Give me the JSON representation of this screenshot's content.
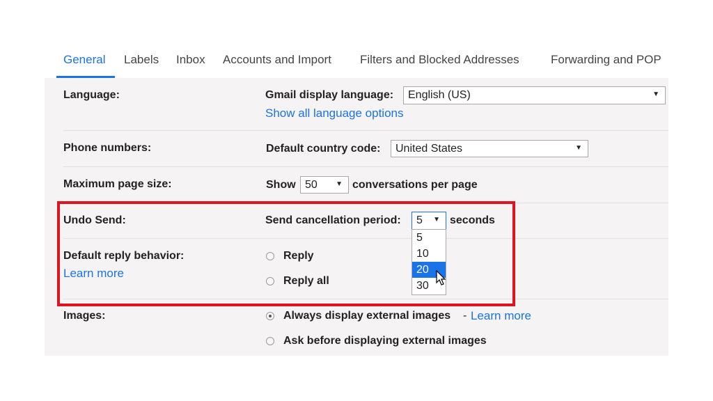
{
  "tabs": [
    {
      "label": "General",
      "active": true
    },
    {
      "label": "Labels"
    },
    {
      "label": "Inbox"
    },
    {
      "label": "Accounts and Import"
    },
    {
      "label": "Filters and Blocked Addresses"
    },
    {
      "label": "Forwarding and POP"
    }
  ],
  "language": {
    "label": "Language:",
    "field_label": "Gmail display language:",
    "value": "English (US)",
    "link": "Show all language options"
  },
  "phone": {
    "label": "Phone numbers:",
    "field_label": "Default country code:",
    "value": "United States"
  },
  "page_size": {
    "label": "Maximum page size:",
    "prefix": "Show",
    "value": "50",
    "suffix": "conversations per page"
  },
  "undo_send": {
    "label": "Undo Send:",
    "field_label": "Send cancellation period:",
    "value": "5",
    "suffix": "seconds",
    "options": [
      "5",
      "10",
      "20",
      "30"
    ],
    "highlighted_option": "20"
  },
  "reply": {
    "label": "Default reply behavior:",
    "learn_more": "Learn more",
    "options": [
      "Reply",
      "Reply all"
    ]
  },
  "images": {
    "label": "Images:",
    "option_always": "Always display external images",
    "separator": "-",
    "learn_more": "Learn more",
    "option_ask": "Ask before displaying external images"
  },
  "colors": {
    "accent": "#1a73e8",
    "highlight_box": "#e0141e",
    "panel_bg": "#f5f3f3"
  }
}
